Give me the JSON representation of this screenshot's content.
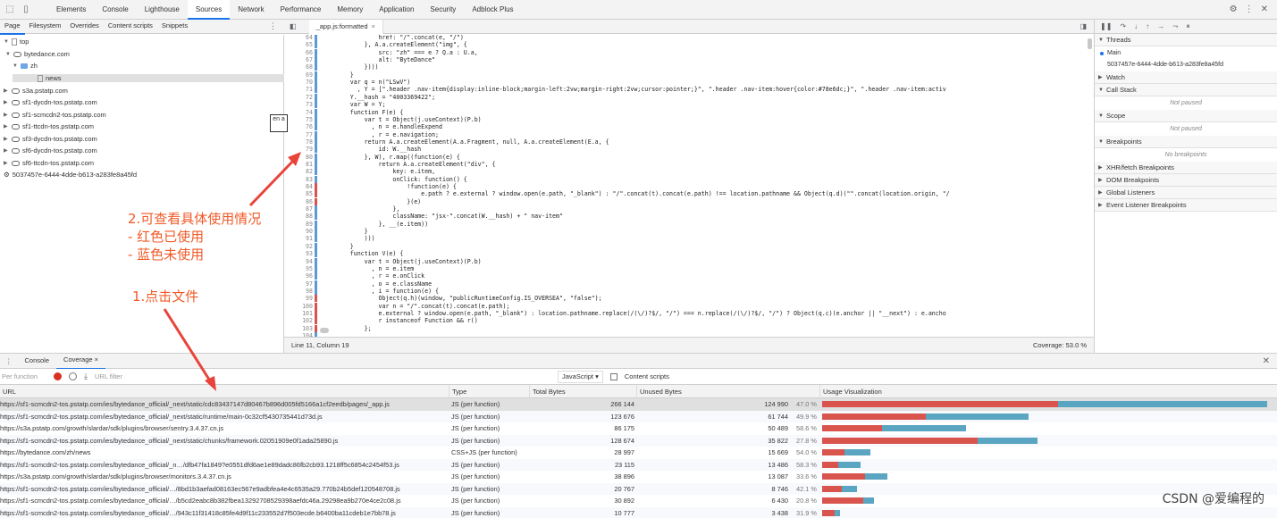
{
  "devtools_tabs": [
    "Elements",
    "Console",
    "Lighthouse",
    "Sources",
    "Network",
    "Performance",
    "Memory",
    "Application",
    "Security",
    "Adblock Plus"
  ],
  "active_tab": "Sources",
  "navigator_tabs": [
    "Page",
    "Filesystem",
    "Overrides",
    "Content scripts",
    "Snippets"
  ],
  "tree": [
    {
      "label": "top",
      "kind": "frame"
    },
    {
      "label": "bytedance.com",
      "kind": "domain"
    },
    {
      "label": "zh",
      "kind": "folder"
    },
    {
      "label": "news",
      "kind": "file"
    },
    {
      "label": "s3a.pstatp.com",
      "kind": "domain"
    },
    {
      "label": "sf1-dycdn-tos.pstatp.com",
      "kind": "domain"
    },
    {
      "label": "sf1-scmcdn2-tos.pstatp.com",
      "kind": "domain"
    },
    {
      "label": "sf1-ttcdn-tos.pstatp.com",
      "kind": "domain"
    },
    {
      "label": "sf3-dycdn-tos.pstatp.com",
      "kind": "domain"
    },
    {
      "label": "sf6-dycdn-tos.pstatp.com",
      "kind": "domain"
    },
    {
      "label": "sf6-ttcdn-tos.pstatp.com",
      "kind": "domain"
    },
    {
      "label": "5037457e-6444-4dde-b613-a283fe8a45fd",
      "kind": "worker"
    }
  ],
  "editor_tab": "_app.js:formatted",
  "code_lines": [
    {
      "n": "64",
      "cov": "blue",
      "text": "                href: \"/\".concat(e, \"/\")"
    },
    {
      "n": "65",
      "cov": "blue",
      "text": "            }, A.a.createElement(\"img\", {"
    },
    {
      "n": "66",
      "cov": "blue",
      "text": "                src: \"zh\" === e ? Q.a : U.a,"
    },
    {
      "n": "67",
      "cov": "blue",
      "text": "                alt: \"ByteDance\""
    },
    {
      "n": "68",
      "cov": "blue",
      "text": "            })))"
    },
    {
      "n": "69",
      "cov": "blue",
      "text": "        }"
    },
    {
      "n": "70",
      "cov": "blue",
      "text": "        var q = n(\"LSwV\")"
    },
    {
      "n": "71",
      "cov": "blue",
      "text": "          , Y = [\".header .nav-item{display:inline-block;margin-left:2vw;margin-right:2vw;cursor:pointer;}\", \".header .nav-item:hover{color:#78e6dc;}\", \".header .nav-item:activ"
    },
    {
      "n": "72",
      "cov": "blue",
      "text": "        Y.__hash = \"4003369422\";"
    },
    {
      "n": "73",
      "cov": "blue",
      "text": "        var W = Y;"
    },
    {
      "n": "74",
      "cov": "blue",
      "text": "        function F(e) {"
    },
    {
      "n": "75",
      "cov": "blue",
      "text": "            var t = Object(j.useContext)(P.b)"
    },
    {
      "n": "76",
      "cov": "blue",
      "text": "              , n = e.handleExpend"
    },
    {
      "n": "77",
      "cov": "blue",
      "text": "              , r = e.navigation;"
    },
    {
      "n": "78",
      "cov": "blue",
      "text": "            return A.a.createElement(A.a.Fragment, null, A.a.createElement(E.a, {"
    },
    {
      "n": "79",
      "cov": "blue",
      "text": "                id: W.__hash"
    },
    {
      "n": "80",
      "cov": "blue",
      "text": "            }, W), r.map((function(e) {"
    },
    {
      "n": "81",
      "cov": "blue",
      "text": "                return A.a.createElement(\"div\", {"
    },
    {
      "n": "82",
      "cov": "blue",
      "text": "                    key: e.item,"
    },
    {
      "n": "83",
      "cov": "blue",
      "text": "                    onClick: function() {"
    },
    {
      "n": "84",
      "cov": "red",
      "text": "                        !function(e) {"
    },
    {
      "n": "85",
      "cov": "red",
      "text": "                            e.path ? e.external ? window.open(e.path, \"_blank\") : \"/\".concat(t).concat(e.path) !== location.pathname && Object(q.d)(\"\".concat(location.origin, \"/"
    },
    {
      "n": "86",
      "cov": "red",
      "text": "                        }(e)"
    },
    {
      "n": "87",
      "cov": "blue",
      "text": "                    },"
    },
    {
      "n": "88",
      "cov": "blue",
      "text": "                    className: \"jsx-\".concat(W.__hash) + \" nav-item\""
    },
    {
      "n": "89",
      "cov": "blue",
      "text": "                }, __(e.item))"
    },
    {
      "n": "90",
      "cov": "blue",
      "text": "            }"
    },
    {
      "n": "91",
      "cov": "blue",
      "text": "            )))"
    },
    {
      "n": "92",
      "cov": "blue",
      "text": "        }"
    },
    {
      "n": "93",
      "cov": "blue",
      "text": "        function V(e) {"
    },
    {
      "n": "94",
      "cov": "blue",
      "text": "            var t = Object(j.useContext)(P.b)"
    },
    {
      "n": "95",
      "cov": "blue",
      "text": "              , n = e.item"
    },
    {
      "n": "96",
      "cov": "blue",
      "text": "              , r = e.onClick"
    },
    {
      "n": "97",
      "cov": "blue",
      "text": "              , o = e.className"
    },
    {
      "n": "98",
      "cov": "blue",
      "text": "              , i = function(e) {"
    },
    {
      "n": "99",
      "cov": "red",
      "text": "                Object(q.h)(window, \"publicRuntimeConfig.IS_OVERSEA\", \"false\");"
    },
    {
      "n": "100",
      "cov": "red",
      "text": "                var n = \"/\".concat(t).concat(e.path);"
    },
    {
      "n": "101",
      "cov": "red",
      "text": "                e.external ? window.open(e.path, \"_blank\") : location.pathname.replace(/(\\/)?$/, \"/\") === n.replace(/(\\/)?$/, \"/\") ? Object(q.c)(e.anchor || \"__next\") : e.ancho"
    },
    {
      "n": "102",
      "cov": "red",
      "text": "                r instanceof Function && r()"
    },
    {
      "n": "103",
      "cov": "red",
      "text": "            };"
    },
    {
      "n": "104",
      "cov": "blue",
      "text": ""
    }
  ],
  "status_left": "Line 11, Column 19",
  "status_right": "Coverage: 53.0 %",
  "debugger": {
    "threads_label": "Threads",
    "main_label": "Main",
    "thread_id": "5037457e-6444-4dde-b613-a283fe8a45fd",
    "watch_label": "Watch",
    "callstack_label": "Call Stack",
    "not_paused": "Not paused",
    "scope_label": "Scope",
    "breakpoints_label": "Breakpoints",
    "no_breakpoints": "No breakpoints",
    "sections": [
      "XHR/fetch Breakpoints",
      "DOM Breakpoints",
      "Global Listeners",
      "Event Listener Breakpoints"
    ]
  },
  "drawer_tabs": [
    "Console",
    "Coverage"
  ],
  "coverage_toolbar": {
    "mode_placeholder": "Per function",
    "url_filter_placeholder": "URL filter",
    "type_select": "JavaScript",
    "content_scripts": "Content scripts"
  },
  "table_headers": {
    "url": "URL",
    "type": "Type",
    "total": "Total Bytes",
    "unused": "Unused Bytes",
    "viz": "Usage Visualization"
  },
  "coverage_rows": [
    {
      "url": "https://sf1-scmcdn2-tos.pstatp.com/ies/bytedance_official/_next/static/cdc83437147d80467b896d005fd5166a1cf2eedb/pages/_app.js",
      "type": "JS (per function)",
      "total": "266 144",
      "unused": "124 990",
      "pct": "47.0 %",
      "total_n": 266144,
      "unused_n": 124990
    },
    {
      "url": "https://sf1-scmcdn2-tos.pstatp.com/ies/bytedance_official/_next/static/runtime/main-0c32cf5430735441d73d.js",
      "type": "JS (per function)",
      "total": "123 676",
      "unused": "61 744",
      "pct": "49.9 %",
      "total_n": 123676,
      "unused_n": 61744
    },
    {
      "url": "https://s3a.pstatp.com/growth/slardar/sdk/plugins/browser/sentry.3.4.37.cn.js",
      "type": "JS (per function)",
      "total": "86 175",
      "unused": "50 489",
      "pct": "58.6 %",
      "total_n": 86175,
      "unused_n": 50489
    },
    {
      "url": "https://sf1-scmcdn2-tos.pstatp.com/ies/bytedance_official/_next/static/chunks/framework.02051909e0f1ada25890.js",
      "type": "JS (per function)",
      "total": "128 674",
      "unused": "35 822",
      "pct": "27.8 %",
      "total_n": 128674,
      "unused_n": 35822
    },
    {
      "url": "https://bytedance.com/zh/news",
      "type": "CSS+JS (per function)",
      "total": "28 997",
      "unused": "15 669",
      "pct": "54.0 %",
      "total_n": 28997,
      "unused_n": 15669
    },
    {
      "url": "https://sf1-scmcdn2-tos.pstatp.com/ies/bytedance_official/_n…/dfb47fa1849?e0551dfd6ae1e89dadc86fb2cb93.1218ff5c6854c2454f53.js",
      "type": "JS (per function)",
      "total": "23 115",
      "unused": "13 486",
      "pct": "58.3 %",
      "total_n": 23115,
      "unused_n": 13486
    },
    {
      "url": "https://s3a.pstatp.com/growth/slardar/sdk/plugins/browser/monitors.3.4.37.cn.js",
      "type": "JS (per function)",
      "total": "38 896",
      "unused": "13 087",
      "pct": "33.6 %",
      "total_n": 38896,
      "unused_n": 13087
    },
    {
      "url": "https://sf1-scmcdn2-tos.pstatp.com/ies/bytedance_official/…/8bd1b3aefad08163ec567e9adbfea4e4c6535a29.770b24b5def120548708.js",
      "type": "JS (per function)",
      "total": "20 767",
      "unused": "8 746",
      "pct": "42.1 %",
      "total_n": 20767,
      "unused_n": 8746
    },
    {
      "url": "https://sf1-scmcdn2-tos.pstatp.com/ies/bytedance_official/…/b5cd2eabc8b382fbea13292708529398aefdc46a.29298ea9b270e4ce2c08.js",
      "type": "JS (per function)",
      "total": "30 892",
      "unused": "6 430",
      "pct": "20.8 %",
      "total_n": 30892,
      "unused_n": 6430
    },
    {
      "url": "https://sf1-scmcdn2-tos.pstatp.com/ies/bytedance_official/…/943c11f31418c85fe4d9f11c233552d7f503ecde.b6400ba11cdeb1e7bb78.js",
      "type": "JS (per function)",
      "total": "10 777",
      "unused": "3 438",
      "pct": "31.9 %",
      "total_n": 10777,
      "unused_n": 3438
    }
  ],
  "annotations": {
    "a2_line1": "2.可查看具体使用情况",
    "a2_line2": "- 红色已使用",
    "a2_line3": "- 蓝色未使用",
    "a1": "1.点击文件"
  },
  "translate_badge": "en a",
  "watermark": "CSDN @爱编程的",
  "colors": {
    "used": "#d9544d",
    "unused": "#5aa5c1",
    "annotation": "#f05a28",
    "accent": "#1a73e8"
  }
}
